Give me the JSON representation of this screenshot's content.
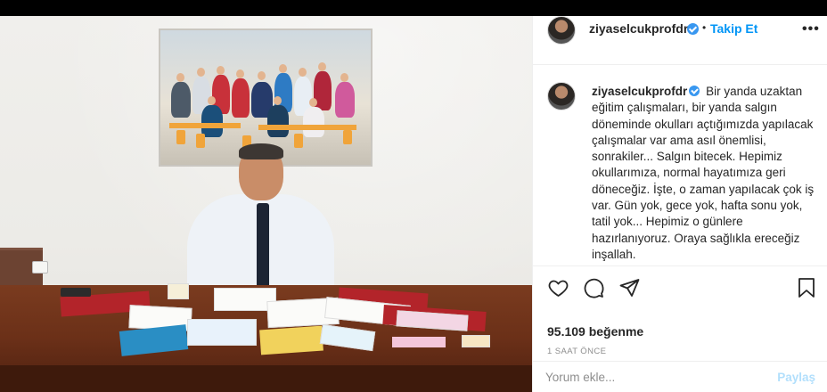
{
  "post": {
    "username": "ziyaselcukprofdr",
    "separator": "•",
    "follow_label": "Takip Et",
    "more_label": "•••",
    "caption": "Bir yanda uzaktan eğitim çalışmaları, bir yanda salgın döneminde okulları açtığımızda yapılacak çalışmalar var ama asıl önemlisi, sonrakiler... Salgın bitecek. Hepimiz okullarımıza, normal hayatımıza geri döneceğiz. İşte, o zaman yapılacak çok iş var. Gün yok, gece yok, hafta sonu yok, tatil yok... Hepimiz o günlere hazırlanıyoruz. Oraya sağlıkla ereceğiz inşallah.",
    "likes_text": "95.109 beğenme",
    "time_text": "1 SAAT ÖNCE"
  },
  "comment": {
    "placeholder": "Yorum ekle...",
    "post_label": "Paylaş"
  },
  "icons": {
    "like": "heart-icon",
    "comment": "comment-bubble-icon",
    "share": "paper-plane-icon",
    "save": "bookmark-icon",
    "verified": "verified-badge-icon"
  },
  "colors": {
    "accent": "#0095f6",
    "verified": "#3897f0",
    "post_disabled": "#b2dffc"
  }
}
